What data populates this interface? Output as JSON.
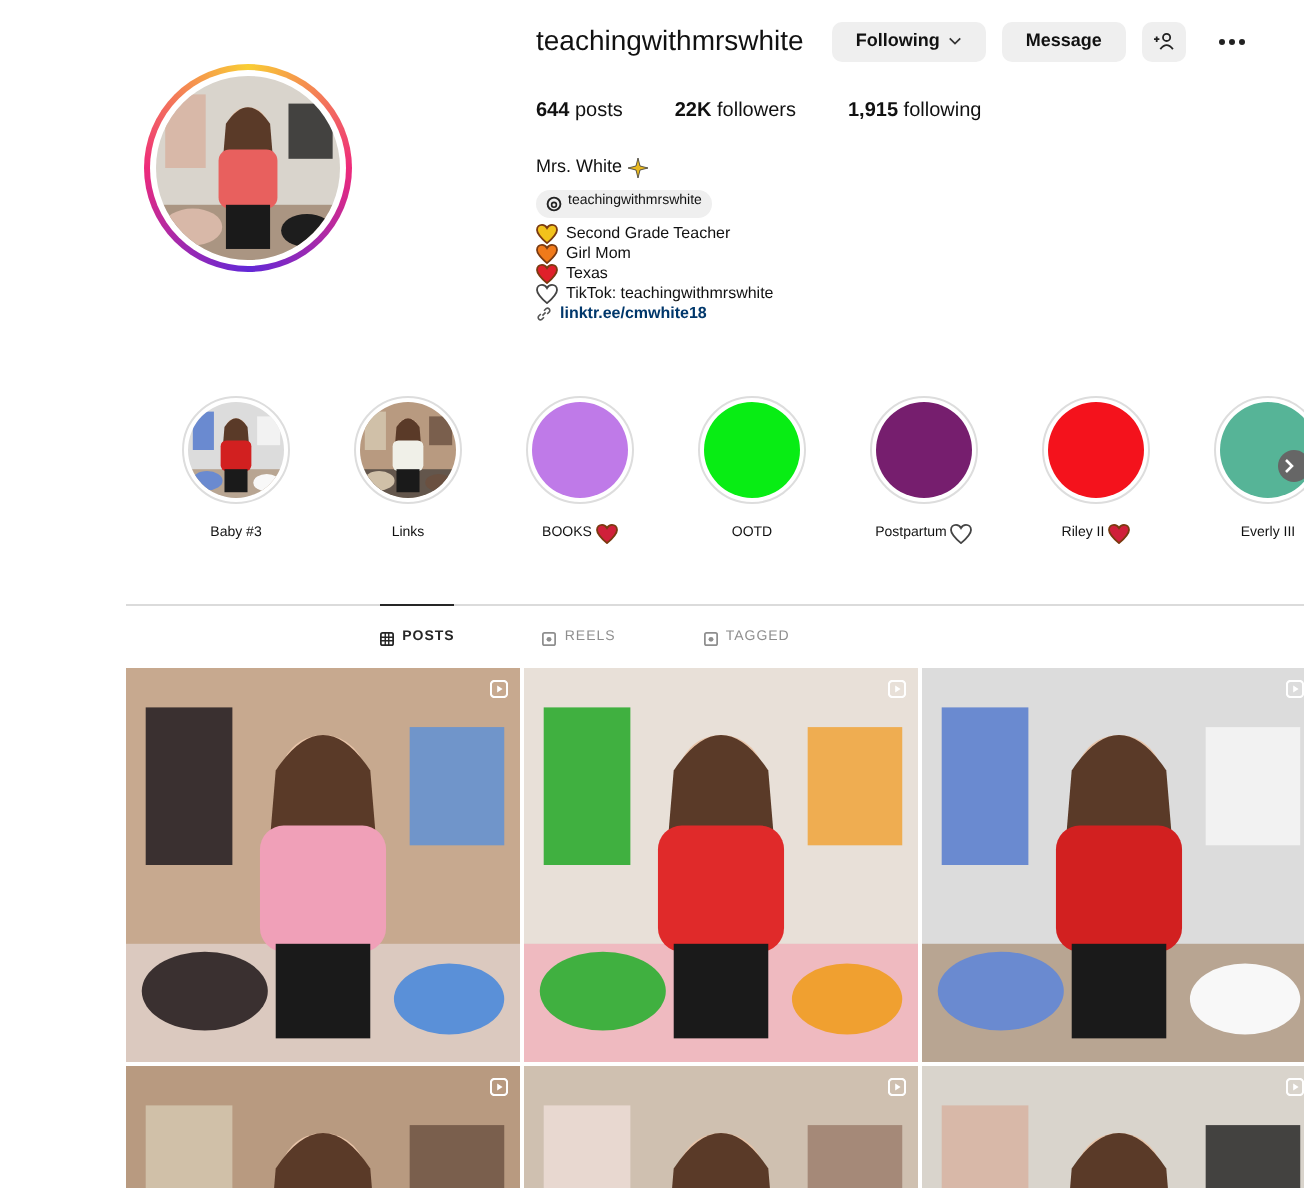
{
  "profile": {
    "username": "teachingwithmrswhite",
    "buttons": [
      {
        "label": "Following",
        "kind": "dropdown"
      },
      {
        "label": "Message",
        "kind": "plain"
      }
    ],
    "stats": [
      {
        "value": "644",
        "label": "posts"
      },
      {
        "value": "22K",
        "label": "followers"
      },
      {
        "value": "1,915",
        "label": "following"
      }
    ],
    "name": "Mrs. White",
    "threads_handle": "teachingwithmrswhite",
    "bio": [
      {
        "text": "Second Grade Teacher",
        "color": "#f2c21b",
        "filled": true
      },
      {
        "text": "Girl Mom",
        "color": "#f07a1a",
        "filled": true
      },
      {
        "text": "Texas",
        "color": "#e0202a",
        "filled": true
      },
      {
        "text": "TikTok: teachingwithmrswhite",
        "color": "#444444",
        "filled": false
      }
    ],
    "link": "linktr.ee/cmwhite18"
  },
  "highlights": [
    {
      "label": "Baby #3",
      "kind": "picture"
    },
    {
      "label": "Links",
      "kind": "picture"
    },
    {
      "label": "BOOKS",
      "kind": "color",
      "color": "#bf7ae8",
      "heart_filled": true
    },
    {
      "label": "OOTD",
      "kind": "color",
      "color": "#08ed14"
    },
    {
      "label": "Postpartum",
      "kind": "color",
      "color": "#761e6e",
      "heart_filled": false
    },
    {
      "label": "Riley II",
      "kind": "color",
      "color": "#f4121c",
      "heart_filled": true
    },
    {
      "label": "Everly III",
      "kind": "color",
      "color": "#56b497"
    }
  ],
  "tabs": [
    {
      "label": "POSTS",
      "selected": true
    },
    {
      "label": "REELS",
      "selected": false
    },
    {
      "label": "TAGGED",
      "selected": false
    }
  ]
}
